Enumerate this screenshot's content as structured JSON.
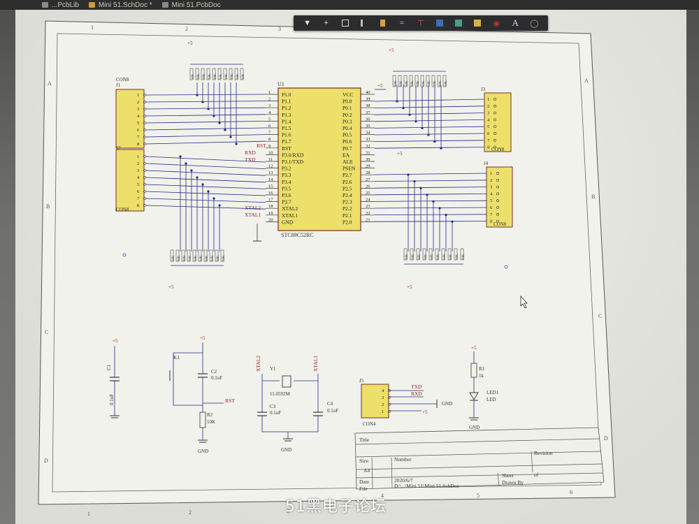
{
  "tabs": [
    {
      "label": "...PcbLib",
      "type": "pcb"
    },
    {
      "label": "Mini 51.SchDoc *",
      "type": "sch"
    },
    {
      "label": "Mini 51.PcbDoc",
      "type": "pcb"
    }
  ],
  "toolbar": {
    "icons": [
      "filter-icon",
      "add-icon",
      "select-rect-icon",
      "align-icon",
      "place-port-icon",
      "place-net-icon",
      "power-port-icon",
      "place-part-icon",
      "sheet-symbol-icon",
      "harness-icon",
      "place-directive-icon",
      "place-text-icon",
      "arc-icon"
    ],
    "text_tool_label": "A"
  },
  "border": {
    "cols_top": [
      "1",
      "2",
      "3"
    ],
    "cols_bottom": [
      "1",
      "2",
      "3",
      "4",
      "5",
      "6"
    ],
    "rows_left": [
      "A",
      "B",
      "C",
      "D"
    ],
    "rows_right": [
      "A",
      "B",
      "C",
      "D"
    ]
  },
  "u1": {
    "designator": "U1",
    "part": "STC89C52RC",
    "left_pins": [
      "P1.0",
      "P1.1",
      "P1.2",
      "P1.3",
      "P1.4",
      "P1.5",
      "P1.6",
      "P1.7",
      "RST",
      "P3.0/RXD",
      "P3.1/TXD",
      "P3.2",
      "P3.3",
      "P3.4",
      "P3.5",
      "P3.6",
      "P3.7",
      "XTAL2",
      "XTAL1",
      "GND"
    ],
    "left_nums": [
      "1",
      "2",
      "3",
      "4",
      "5",
      "6",
      "7",
      "8",
      "9",
      "10",
      "11",
      "12",
      "13",
      "14",
      "15",
      "16",
      "17",
      "18",
      "19",
      "20"
    ],
    "right_pins": [
      "VCC",
      "P0.0",
      "P0.1",
      "P0.2",
      "P0.3",
      "P0.4",
      "P0.5",
      "P0.6",
      "P0.7",
      "EA",
      "ALE",
      "PSEN",
      "P2.7",
      "P2.6",
      "P2.5",
      "P2.4",
      "P2.3",
      "P2.2",
      "P2.1",
      "P2.0"
    ],
    "right_nums": [
      "40",
      "39",
      "38",
      "37",
      "36",
      "35",
      "34",
      "33",
      "32",
      "31",
      "30",
      "29",
      "28",
      "27",
      "26",
      "25",
      "24",
      "23",
      "22",
      "21"
    ],
    "net_rst": "RST",
    "net_rxd": "RXD",
    "net_txd": "TXD",
    "net_xtal2": "XTAL2",
    "net_xtal1": "XTAL1",
    "vcc": "+5"
  },
  "connectors": {
    "j1": {
      "designator": "J1",
      "title": "CON8",
      "pins": [
        "1",
        "2",
        "3",
        "4",
        "5",
        "6",
        "7",
        "8"
      ]
    },
    "j2": {
      "designator": "J2",
      "title": "CON8",
      "pins": [
        "1",
        "2",
        "3",
        "4",
        "5",
        "6",
        "7",
        "8"
      ]
    },
    "j3": {
      "designator": "J3",
      "title": "CON8",
      "pins": [
        "1",
        "2",
        "3",
        "4",
        "5",
        "6",
        "7",
        "8"
      ]
    },
    "j4": {
      "designator": "J4",
      "title": "CON8",
      "pins": [
        "1",
        "2",
        "3",
        "4",
        "5",
        "6",
        "7",
        "8"
      ]
    },
    "j5": {
      "designator": "J5",
      "title": "CON4",
      "pins": [
        "4",
        "3",
        "2",
        "1"
      ]
    }
  },
  "power": {
    "p5": "+5",
    "gnd": "GND"
  },
  "reset": {
    "k1": "K1",
    "c2": "C2",
    "c2_val": "0.1uF",
    "r2": "R2",
    "r2_val": "10K",
    "net": "RST"
  },
  "crystal": {
    "y1": "Y1",
    "y1_val": "11.0592M",
    "c3": "C3",
    "c3_val": "0.1uF",
    "c4": "C4",
    "c4_val": "0.1uF",
    "xtal2": "XTAL2",
    "xtal1": "XTAL1"
  },
  "decoupling": {
    "c1": "C1",
    "c1_val": "0.1uF"
  },
  "serial": {
    "txd": "TXD",
    "rxd": "RXD",
    "gnd": "GND",
    "p5": "+5"
  },
  "led": {
    "r1": "R1",
    "r1_val": "1k",
    "led1": "LED1",
    "led": "LED"
  },
  "resistor_banks": {
    "label": "10K"
  },
  "title_block": {
    "title_label": "Title",
    "size_label": "Size",
    "size_val": "A4",
    "number_label": "Number",
    "revision_label": "Revision",
    "date_label": "Date",
    "date_val": "2020/6/7",
    "sheet_label": "Sheet",
    "of_label": "of",
    "file_label": "File",
    "file_val": "D:\\...\\Mini 51\\Mini 51.SchDoc",
    "drawn_label": "Drawn By"
  },
  "watermark": "51黑电子论坛"
}
